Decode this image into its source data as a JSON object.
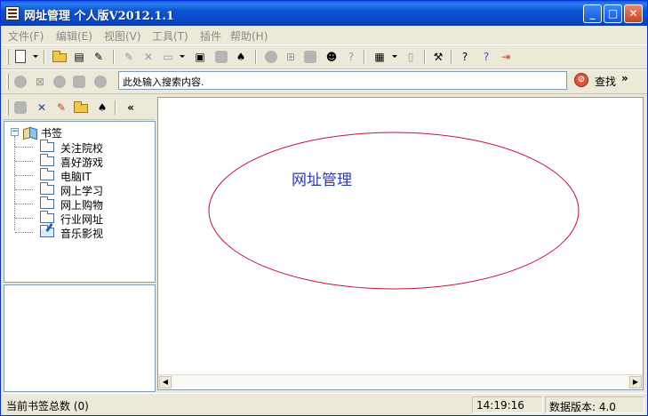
{
  "window": {
    "title": "网址管理 个人版V2012.1.1",
    "min_glyph": "_",
    "max_glyph": "□",
    "close_glyph": "✕"
  },
  "menu": [
    "文件(F)",
    "编辑(E)",
    "视图(V)",
    "工具(T)",
    "插件",
    "帮助(H)"
  ],
  "toolbar2": {
    "search_value": "此处输入搜索内容.",
    "search_button": "查找",
    "more_glyph": "»"
  },
  "left_toolbar": {
    "collapse_glyph": "«"
  },
  "tree": {
    "root": "书签",
    "items": [
      "关注院校",
      "喜好游戏",
      "电脑IT",
      "网上学习",
      "网上购物",
      "行业网址",
      "音乐影视"
    ]
  },
  "main": {
    "logo_text": "网址管理"
  },
  "statusbar": {
    "bookmark_count": "当前书签总数 (0)",
    "time": "14:19:16",
    "data_version": "数据版本: 4.0"
  },
  "colors": {
    "logo_ellipse": "#c8102e",
    "logo_text": "#2b3bb8",
    "titlebar": "#0a54d6"
  }
}
